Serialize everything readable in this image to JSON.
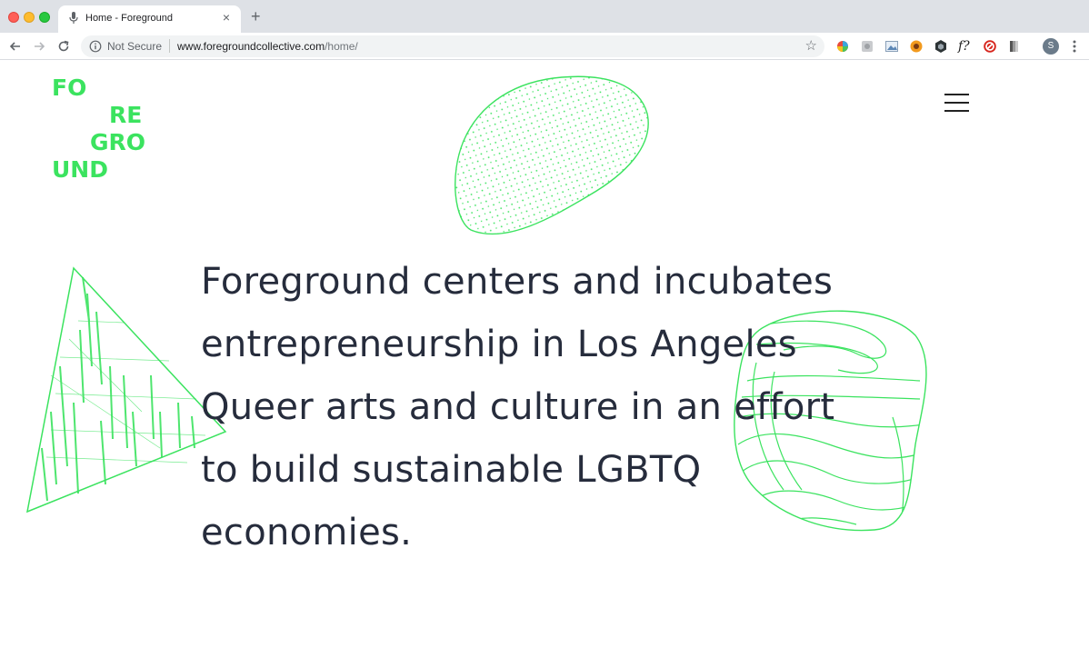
{
  "browser": {
    "tab_title": "Home - Foreground",
    "new_tab_label": "+",
    "close_label": "×",
    "security_label": "Not Secure",
    "url_host": "www.foregroundcollective.com",
    "url_path": "/home/",
    "avatar_initial": "S",
    "extensions": [
      "color-wheel-extension-icon",
      "gray-extension-icon",
      "image-extension-icon",
      "sunflower-extension-icon",
      "hexagon-extension-icon",
      "font-extension-icon",
      "red-block-extension-icon",
      "gradient-extension-icon"
    ],
    "font_ext_label": "f?"
  },
  "site": {
    "logo_lines": [
      "FO",
      "RE",
      "GRO",
      "UND"
    ],
    "accent_color": "#3be35f",
    "text_color": "#262c3c",
    "hero_lines": [
      "Foreground centers and incubates",
      "entrepreneurship in Los Angeles",
      "Queer arts and culture in an effort",
      "to build sustainable LGBTQ",
      "economies."
    ]
  }
}
